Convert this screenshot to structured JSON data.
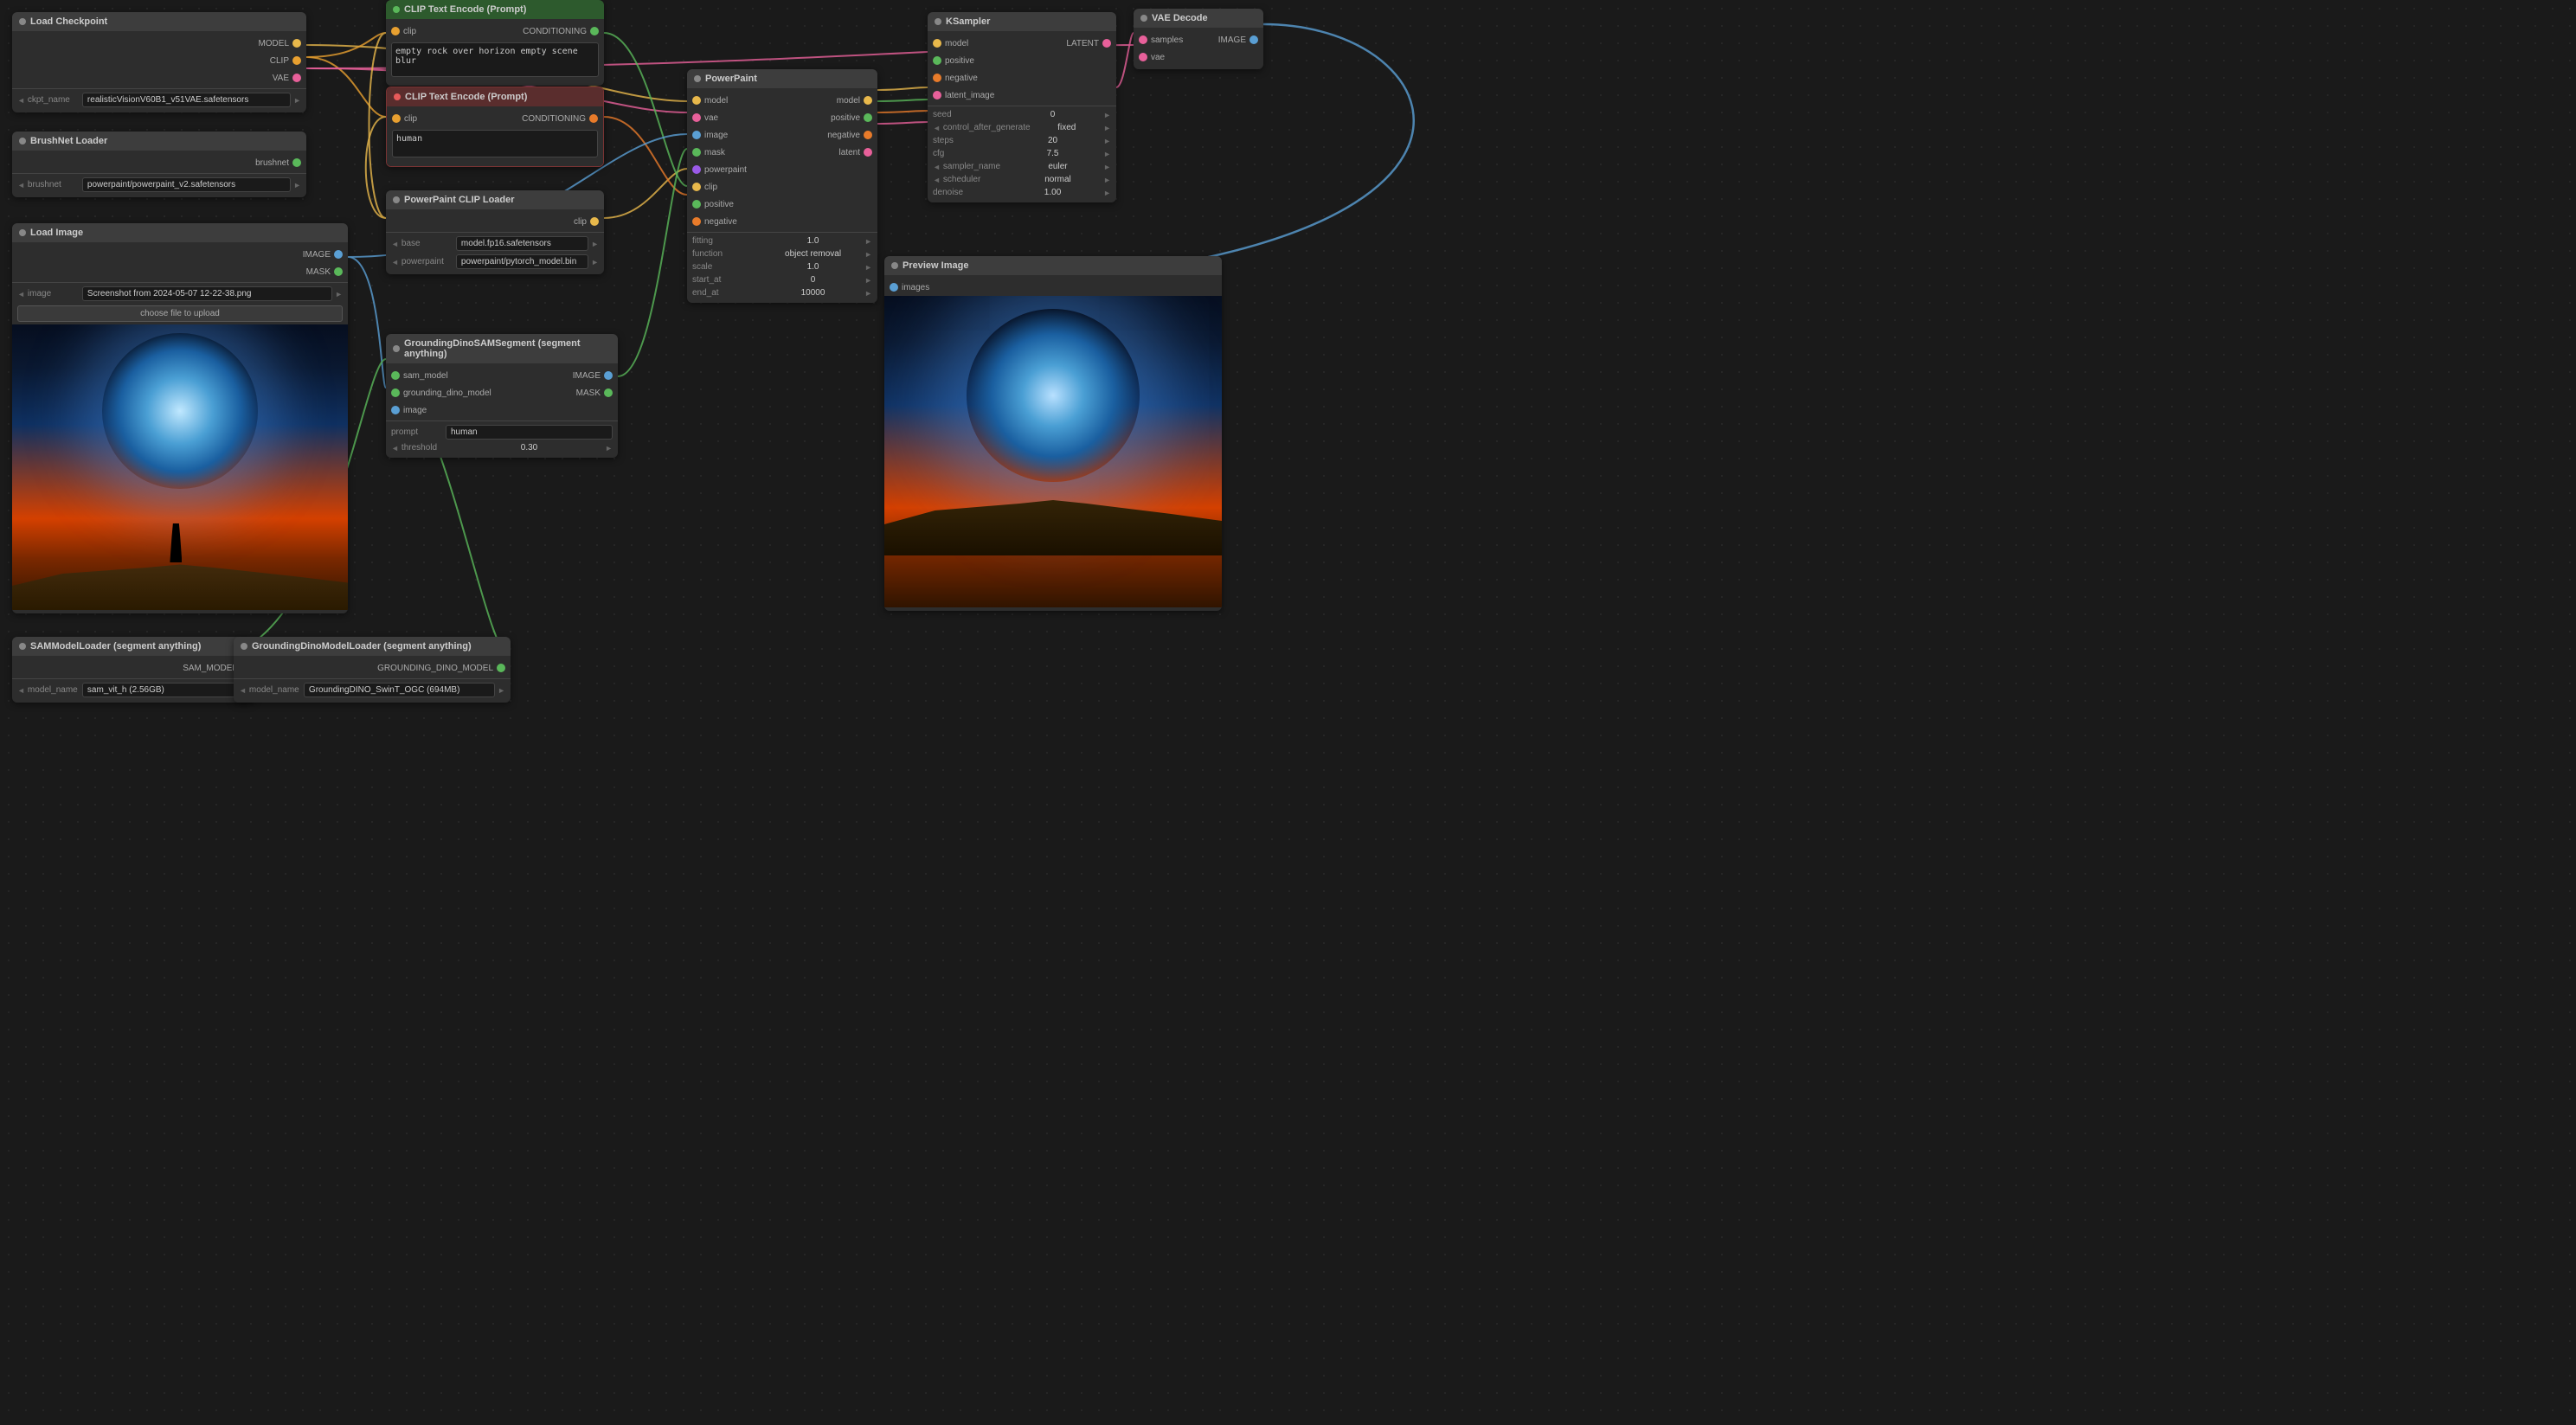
{
  "nodes": {
    "load_checkpoint": {
      "title": "Load Checkpoint",
      "outputs": [
        "MODEL",
        "CLIP",
        "VAE"
      ],
      "fields": [
        {
          "label": "ckpt_name",
          "value": "realisticVisionV60B1_v51VAE.safetensors"
        }
      ]
    },
    "brushnet_loader": {
      "title": "BrushNet Loader",
      "outputs": [
        "brushnet"
      ],
      "fields": [
        {
          "label": "brushnet",
          "value": "powerpaint/powerpaint_v2.safetensors"
        }
      ]
    },
    "load_image": {
      "title": "Load Image",
      "outputs": [
        "IMAGE",
        "MASK"
      ],
      "fields": [
        {
          "label": "image",
          "value": "Screenshot from 2024-05-07 12-22-38.png"
        },
        {
          "label": "choose file to upload",
          "value": ""
        }
      ]
    },
    "clip_text_pos": {
      "title": "CLIP Text Encode (Prompt)",
      "inputs": [
        "clip"
      ],
      "outputs": [
        "CONDITIONING"
      ],
      "text": "empty rock over horizon empty scene blur"
    },
    "clip_text_neg": {
      "title": "CLIP Text Encode (Prompt)",
      "inputs": [
        "clip"
      ],
      "outputs": [
        "CONDITIONING"
      ],
      "text": "human"
    },
    "powerpaint_clip": {
      "title": "PowerPaint CLIP Loader",
      "outputs": [
        "clip"
      ],
      "fields": [
        {
          "label": "base",
          "value": "model.fp16.safetensors"
        },
        {
          "label": "powerpaint",
          "value": "powerpaint/pytorch_model.bin"
        }
      ]
    },
    "gdino_sam": {
      "title": "GroundingDinoSAMSegment (segment anything)",
      "inputs": [
        "sam_model",
        "grounding_dino_model",
        "image"
      ],
      "outputs": [
        "IMAGE",
        "MASK"
      ],
      "fields": [
        {
          "label": "prompt",
          "value": "human"
        },
        {
          "label": "threshold",
          "value": "0.30"
        }
      ]
    },
    "powerpaint": {
      "title": "PowerPaint",
      "inputs": [
        "model",
        "vae",
        "image",
        "mask",
        "powerpaint",
        "clip",
        "positive",
        "negative"
      ],
      "outputs": [
        "model",
        "positive",
        "negative",
        "latent"
      ],
      "fields": [
        {
          "label": "fitting",
          "value": "1.0"
        },
        {
          "label": "function",
          "value": "object removal"
        },
        {
          "label": "scale",
          "value": "1.0"
        },
        {
          "label": "start_at",
          "value": "0"
        },
        {
          "label": "end_at",
          "value": "10000"
        }
      ]
    },
    "ksampler": {
      "title": "KSampler",
      "inputs": [
        "model",
        "positive",
        "negative",
        "latent_image"
      ],
      "outputs": [
        "LATENT"
      ],
      "fields": [
        {
          "label": "seed",
          "value": "0"
        },
        {
          "label": "control_after_generate",
          "value": "fixed"
        },
        {
          "label": "steps",
          "value": "20"
        },
        {
          "label": "cfg",
          "value": "7.5"
        },
        {
          "label": "sampler_name",
          "value": "euler"
        },
        {
          "label": "scheduler",
          "value": "normal"
        },
        {
          "label": "denoise",
          "value": "1.00"
        }
      ]
    },
    "vae_decode": {
      "title": "VAE Decode",
      "inputs": [
        "samples",
        "vae"
      ],
      "outputs": [
        "IMAGE"
      ]
    },
    "preview_image": {
      "title": "Preview Image",
      "inputs": [
        "images"
      ]
    },
    "sam_loader": {
      "title": "SAMModelLoader (segment anything)",
      "outputs": [
        "SAM_MODEL"
      ],
      "fields": [
        {
          "label": "model_name",
          "value": "sam_vit_h (2.56GB)"
        }
      ]
    },
    "gdino_loader": {
      "title": "GroundingDinoModelLoader (segment anything)",
      "outputs": [
        "GROUNDING_DINO_MODEL"
      ],
      "fields": [
        {
          "label": "model_name",
          "value": "GroundingDINO_SwinT_OGC (694MB)"
        }
      ]
    }
  },
  "colors": {
    "dot_yellow": "#e8b84b",
    "dot_orange": "#e87b2a",
    "dot_pink": "#e8609a",
    "dot_blue": "#5a9fd4",
    "dot_green": "#5ab85a",
    "dot_purple": "#9a5ae8",
    "dot_red": "#e85a5a",
    "dot_cyan": "#5ae8e8",
    "dot_lime": "#a0e85a",
    "header_dark": "#3d3d3d",
    "header_green": "#2d5a2d",
    "header_red": "#5a2d2d",
    "node_bg": "#2d2d2d",
    "wire_yellow": "#e8b84b",
    "wire_orange": "#e87b2a",
    "wire_pink": "#e8609a",
    "wire_blue": "#5a9fd4",
    "wire_green": "#5ab85a",
    "wire_cyan": "#5ae8e8",
    "wire_purple": "#9a5ae8",
    "wire_lime": "#a0e85a"
  }
}
